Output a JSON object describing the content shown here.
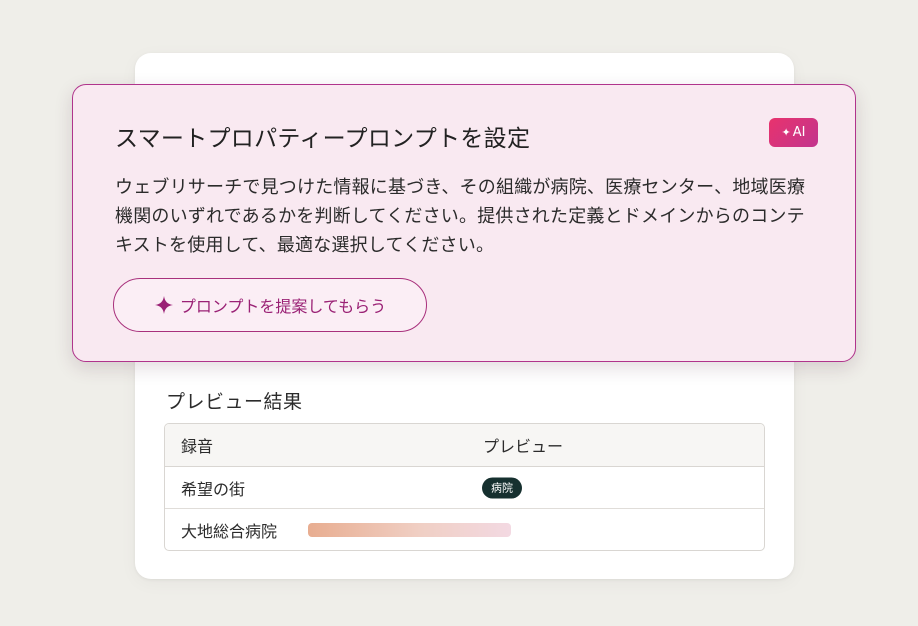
{
  "ai_panel": {
    "title": "スマートプロパティープロンプトを設定",
    "badge": "AI",
    "body": "ウェブリサーチで見つけた情報に基づき、その組織が病院、医療センター、地域医療機関のいずれであるかを判断してください。提供された定義とドメインからのコンテキストを使用して、最適な選択してください。",
    "suggest_button": "プロンプトを提案してもらう"
  },
  "preview": {
    "title": "プレビュー結果",
    "columns": [
      "録音",
      "プレビュー"
    ],
    "rows": [
      {
        "name": "希望の街",
        "preview": "病院"
      },
      {
        "name": "大地総合病院",
        "preview": "",
        "loading": true
      }
    ]
  },
  "colors": {
    "accent": "#b0348c",
    "panel_bg": "#f9e9f1",
    "badge_dark": "#16302f"
  },
  "icons": {
    "ai_badge": "sparkle-icon",
    "suggest_button": "sparkle-icon"
  }
}
